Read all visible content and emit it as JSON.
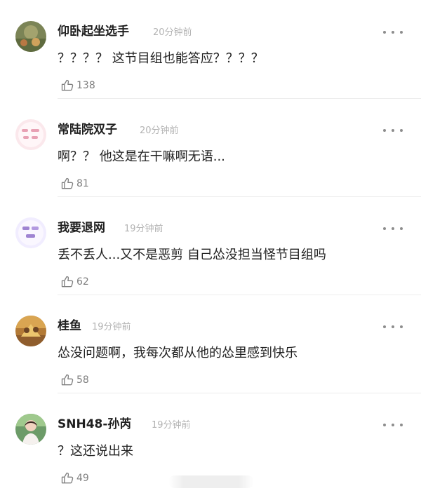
{
  "comments": [
    {
      "username": "仰卧起坐选手",
      "time": "20分钟前",
      "text": "？？？？ 这节目组也能答应？？？？",
      "likes": "138",
      "avatar_icon": "green-scenery-avatar-icon"
    },
    {
      "username": "常陆院双子",
      "time": "20分钟前",
      "text": "啊？？ 他这是在干嘛啊无语...",
      "likes": "81",
      "avatar_icon": "pink-text-avatar-icon"
    },
    {
      "username": "我要退网",
      "time": "19分钟前",
      "text": "丢不丢人...又不是恶剪 自己怂没担当怪节目组吗",
      "likes": "62",
      "avatar_icon": "purple-text-avatar-icon"
    },
    {
      "username": "桂鱼",
      "time": "19分钟前",
      "text": "怂没问题啊，我每次都从他的怂里感到快乐",
      "likes": "58",
      "avatar_icon": "orange-photo-avatar-icon"
    },
    {
      "username": "SNH48-孙芮",
      "time": "19分钟前",
      "text": "？这还说出来",
      "likes": "49",
      "avatar_icon": "person-photo-avatar-icon"
    }
  ],
  "icons": {
    "more": "more-dots-icon",
    "like": "thumbs-up-icon"
  },
  "colors": {
    "username": "#1f1f1f",
    "time": "#b3b3b3",
    "text": "#222222",
    "like": "#7f7f7f",
    "divider": "#ececec"
  }
}
